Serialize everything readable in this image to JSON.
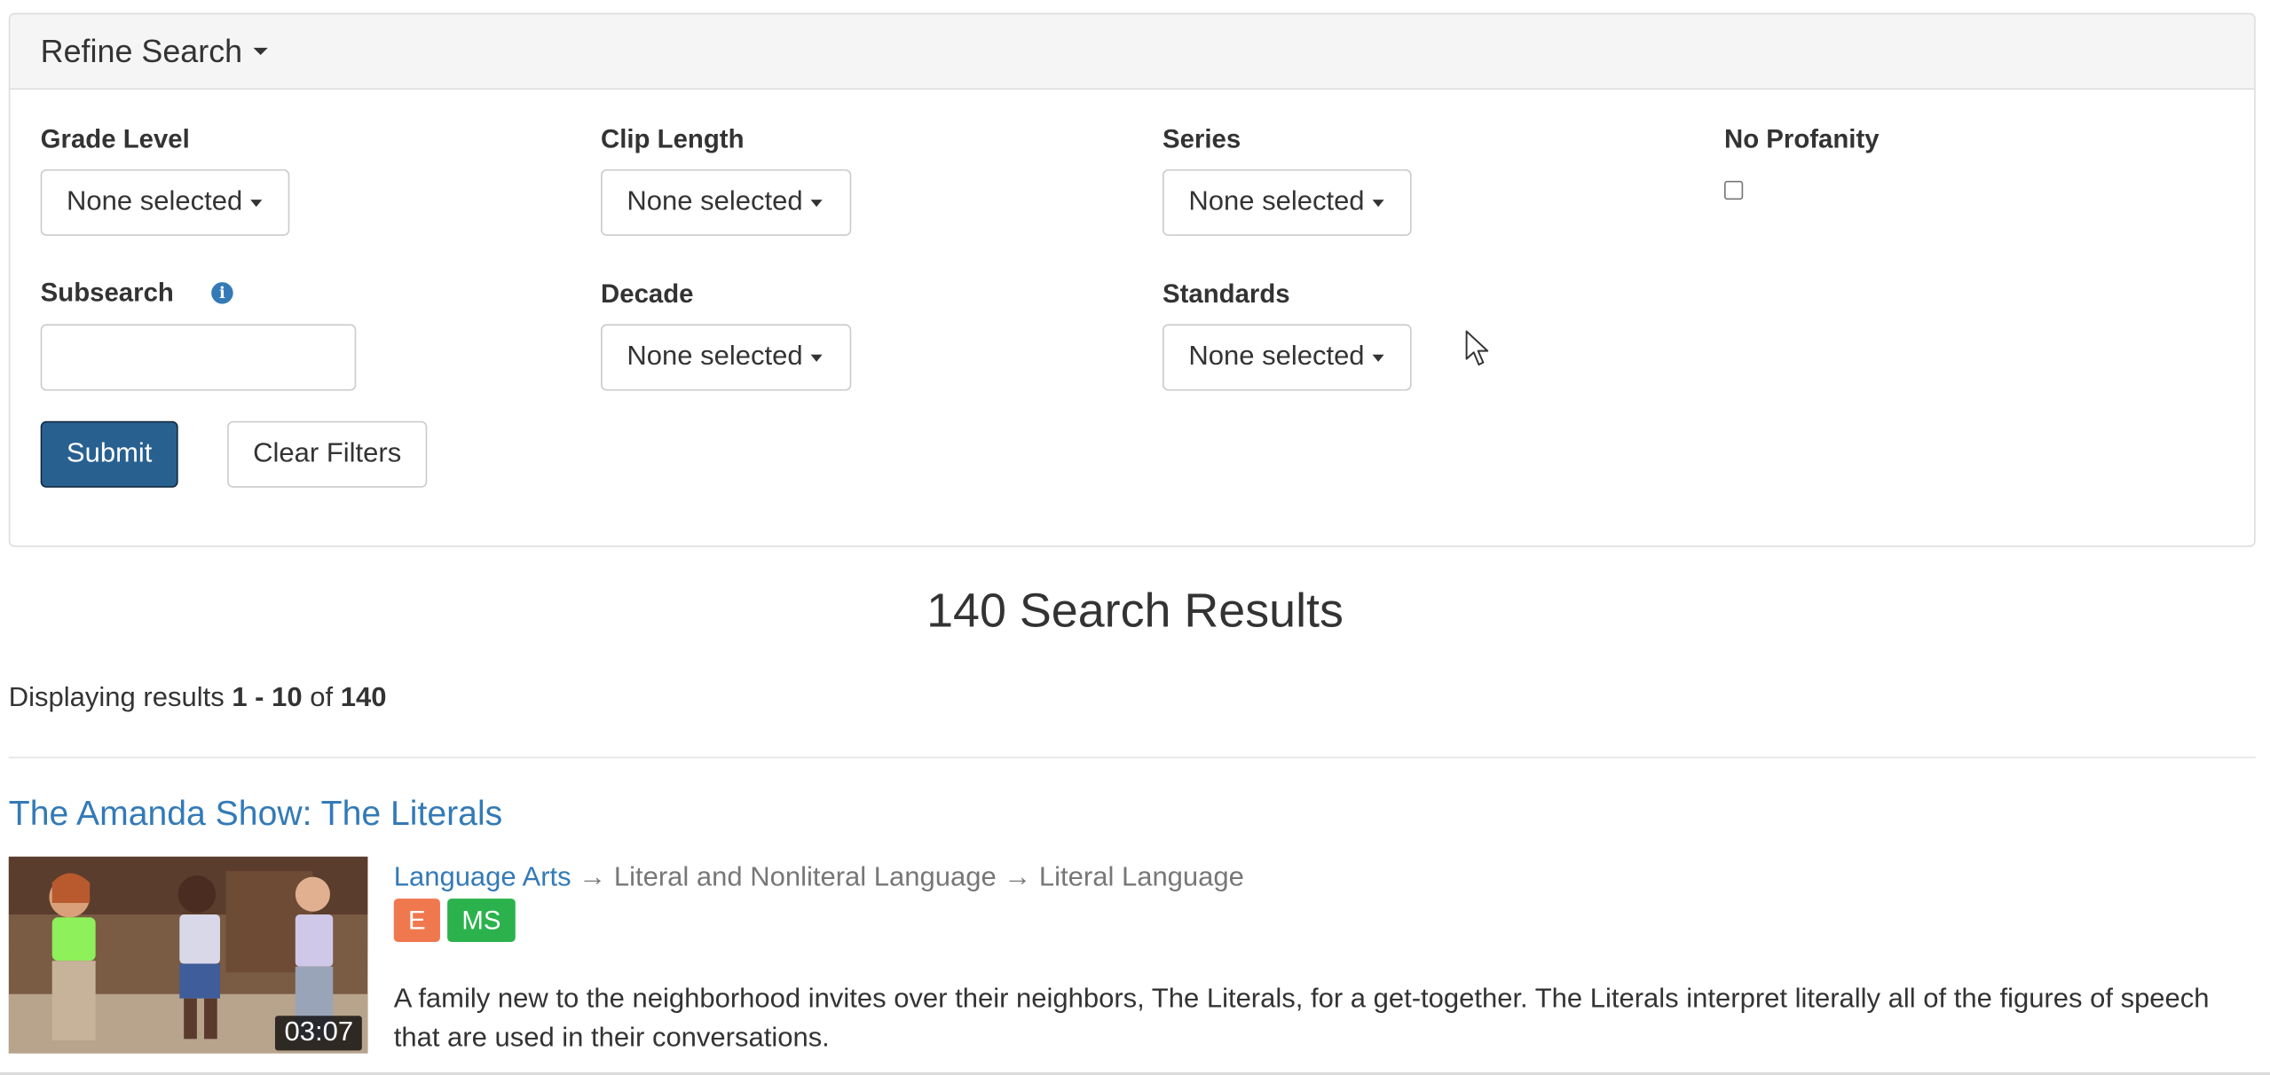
{
  "refine": {
    "title": "Refine Search",
    "filters": {
      "grade_level": {
        "label": "Grade Level",
        "value": "None selected"
      },
      "clip_length": {
        "label": "Clip Length",
        "value": "None selected"
      },
      "series": {
        "label": "Series",
        "value": "None selected"
      },
      "no_profanity": {
        "label": "No Profanity",
        "checked": false
      },
      "subsearch": {
        "label": "Subsearch",
        "value": "",
        "placeholder": ""
      },
      "decade": {
        "label": "Decade",
        "value": "None selected"
      },
      "standards": {
        "label": "Standards",
        "value": "None selected"
      }
    },
    "submit_label": "Submit",
    "clear_label": "Clear Filters"
  },
  "results": {
    "heading": "140 Search Results",
    "display_prefix": "Displaying results",
    "range": "1 - 10",
    "of": "of",
    "total": "140"
  },
  "items": [
    {
      "title": "The Amanda Show: The Literals",
      "duration": "03:07",
      "subject": "Language Arts",
      "path": "→ Literal and Nonliteral Language → Literal Language",
      "badges": [
        {
          "label": "E",
          "color": "#f0784e"
        },
        {
          "label": "MS",
          "color": "#2bb24c"
        }
      ],
      "description": "A family new to the neighborhood invites over their neighbors, The Literals, for a get-together. The Literals interpret literally all of the figures of speech that are used in their conversations."
    }
  ],
  "colors": {
    "primary": "#286090",
    "link": "#337ab7",
    "badge_e": "#f0784e",
    "badge_ms": "#2bb24c"
  }
}
